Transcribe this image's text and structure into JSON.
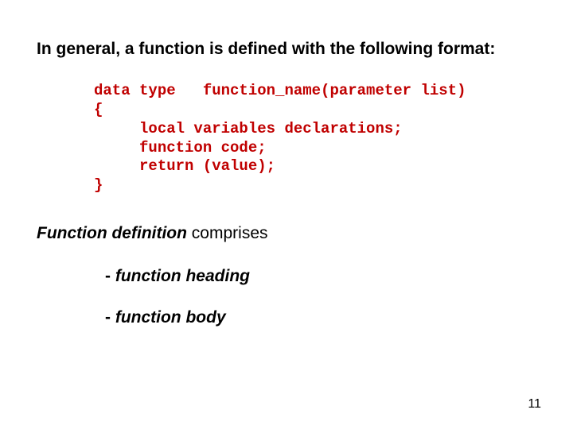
{
  "intro": "In general, a function is defined with the following format:",
  "code": {
    "line1": "data type   function_name(parameter list)",
    "line2": "{",
    "line3": "     local variables declarations;",
    "line4": "     function code;",
    "line5": "     return (value);",
    "line6": "}"
  },
  "definition": {
    "term": "Function definition",
    "rest": " comprises"
  },
  "bullets": {
    "b1_prefix": "- ",
    "b1": "function heading",
    "b2_prefix": "- ",
    "b2": "function body"
  },
  "page_number": "11"
}
